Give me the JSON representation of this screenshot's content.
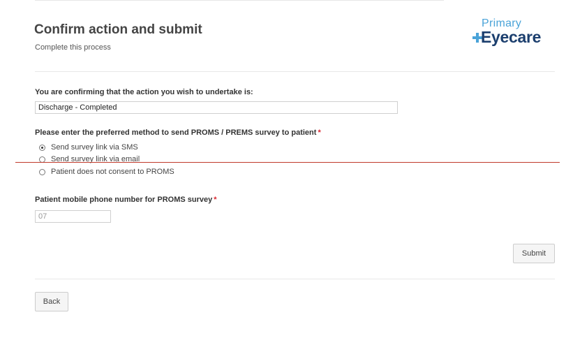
{
  "header": {
    "title": "Confirm action and submit",
    "subtitle": "Complete this process"
  },
  "logo": {
    "line1": "Primary",
    "line2": "Eyecare"
  },
  "action": {
    "label": "You are confirming that the action you wish to undertake is:",
    "value": "Discharge - Completed"
  },
  "survey_method": {
    "label": "Please enter the preferred method to send PROMS / PREMS survey to patient",
    "required_mark": "*",
    "options": [
      {
        "label": "Send survey link via SMS",
        "checked": true
      },
      {
        "label": "Send survey link via email",
        "checked": false
      },
      {
        "label": "Patient does not consent to PROMS",
        "checked": false
      }
    ]
  },
  "phone": {
    "label": "Patient mobile phone number for PROMS survey",
    "required_mark": "*",
    "value": "07"
  },
  "buttons": {
    "submit": "Submit",
    "back": "Back"
  },
  "colors": {
    "required": "#d9262f",
    "logo_primary": "#4aa3d8",
    "logo_eyecare": "#1c3f6e",
    "annotation_line": "#c0392b"
  }
}
